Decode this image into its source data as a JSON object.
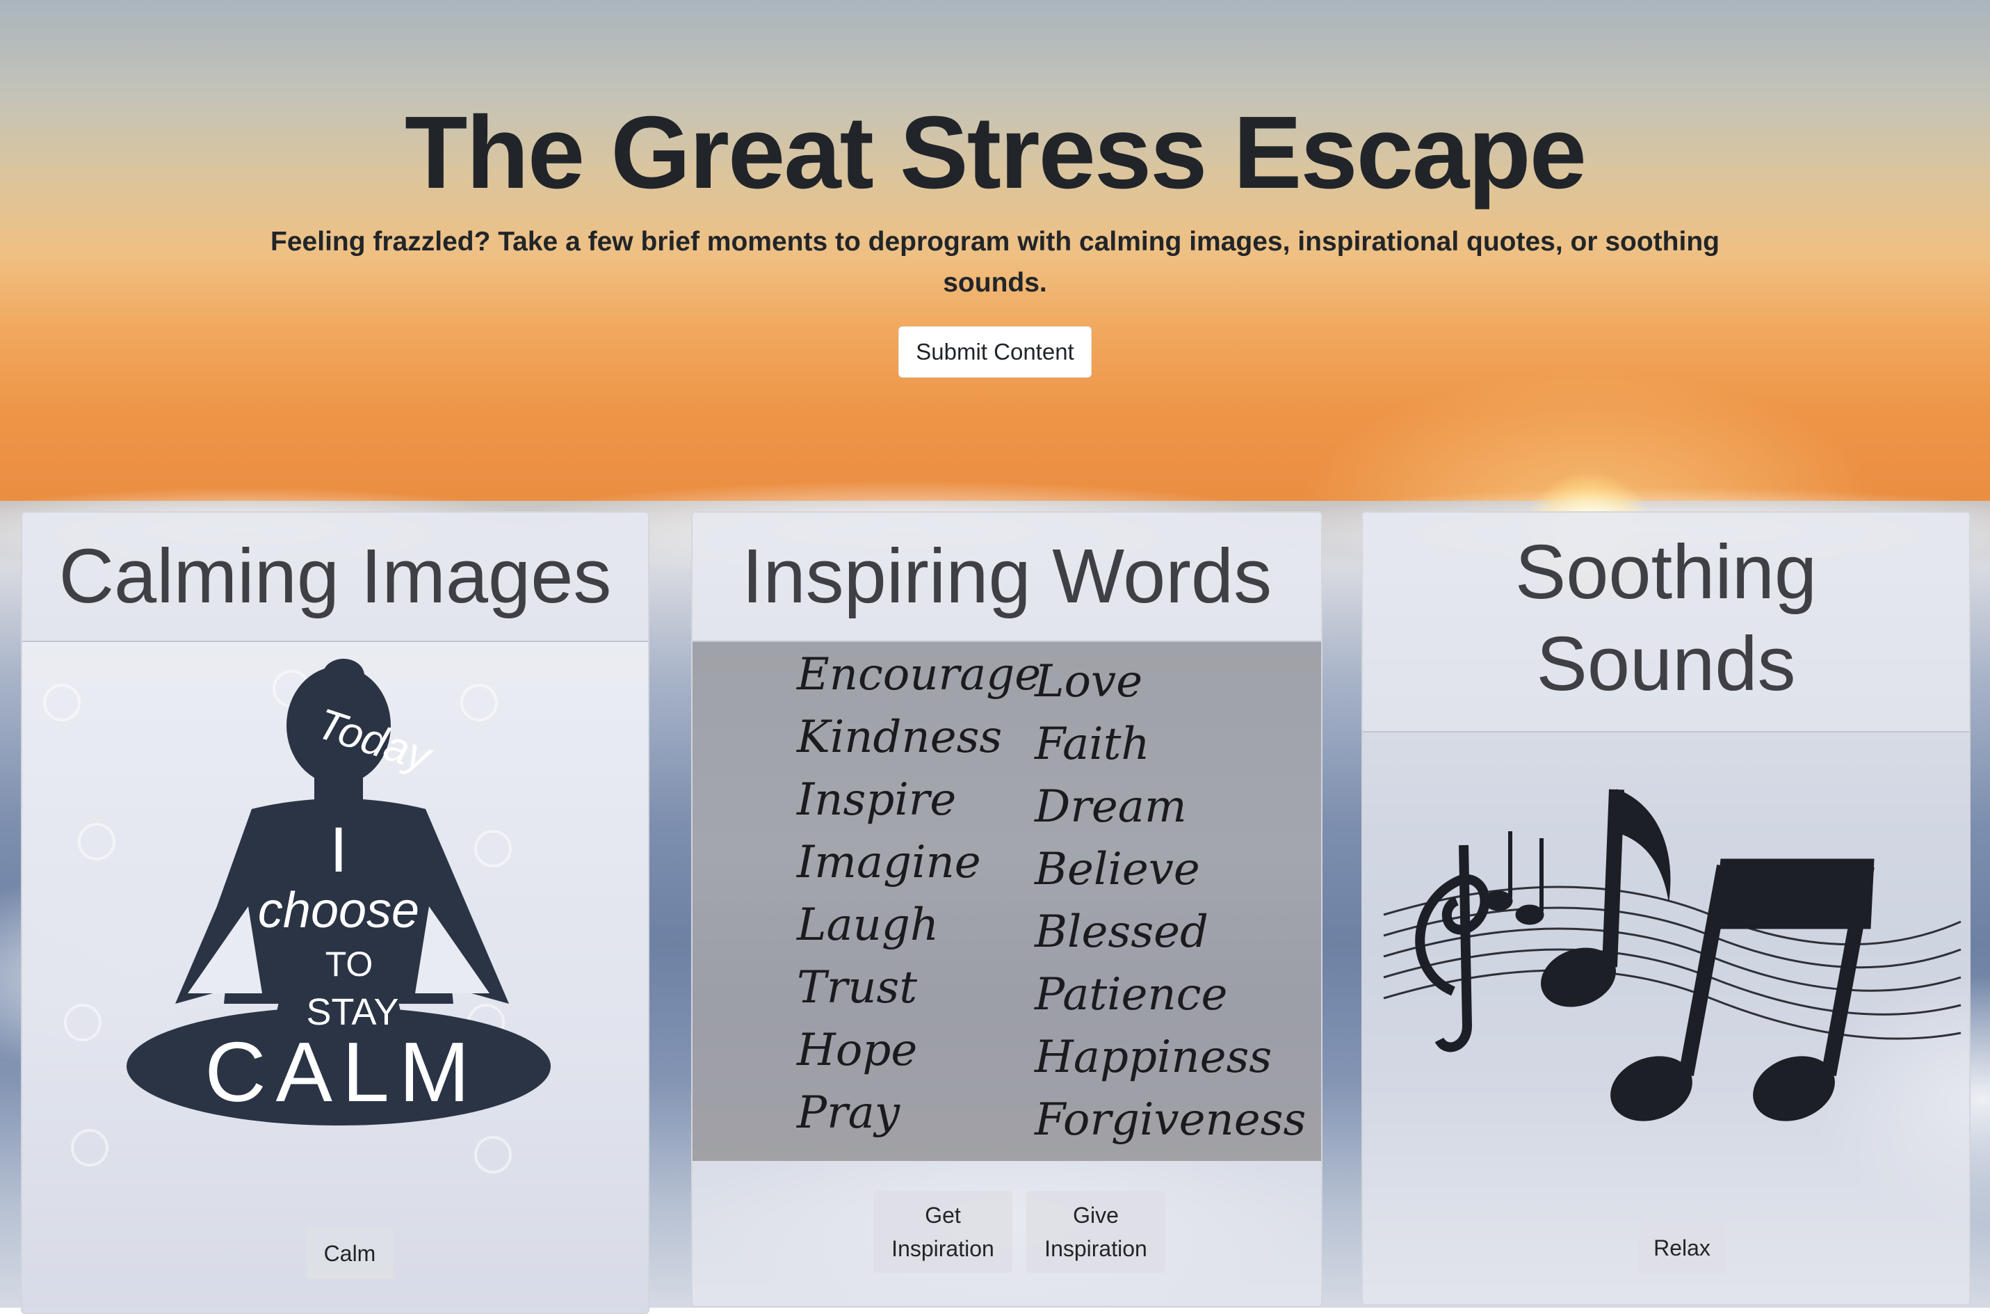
{
  "header": {
    "title": "The Great Stress Escape",
    "subtitle": "Feeling frazzled? Take a few brief moments to deprogram with calming images, inspirational quotes, or soothing sounds.",
    "submit_label": "Submit Content"
  },
  "cards": {
    "images": {
      "title": "Calming Images",
      "poster_words": [
        "Today",
        "I",
        "choose",
        "TO",
        "STAY",
        "CALM"
      ],
      "button_label": "Calm"
    },
    "words": {
      "title": "Inspiring Words",
      "left_words": [
        "Encourage",
        "Kindness",
        "Inspire",
        "Imagine",
        "Laugh",
        "Trust",
        "Hope",
        "Pray"
      ],
      "right_words": [
        "Love",
        "Faith",
        "Dream",
        "Believe",
        "Blessed",
        "Patience",
        "Happiness",
        "Forgiveness"
      ],
      "get_label_line1": "Get",
      "get_label_line2": "Inspiration",
      "give_label_line1": "Give",
      "give_label_line2": "Inspiration"
    },
    "sounds": {
      "title_line1": "Soothing",
      "title_line2": "Sounds",
      "button_label": "Relax"
    }
  }
}
